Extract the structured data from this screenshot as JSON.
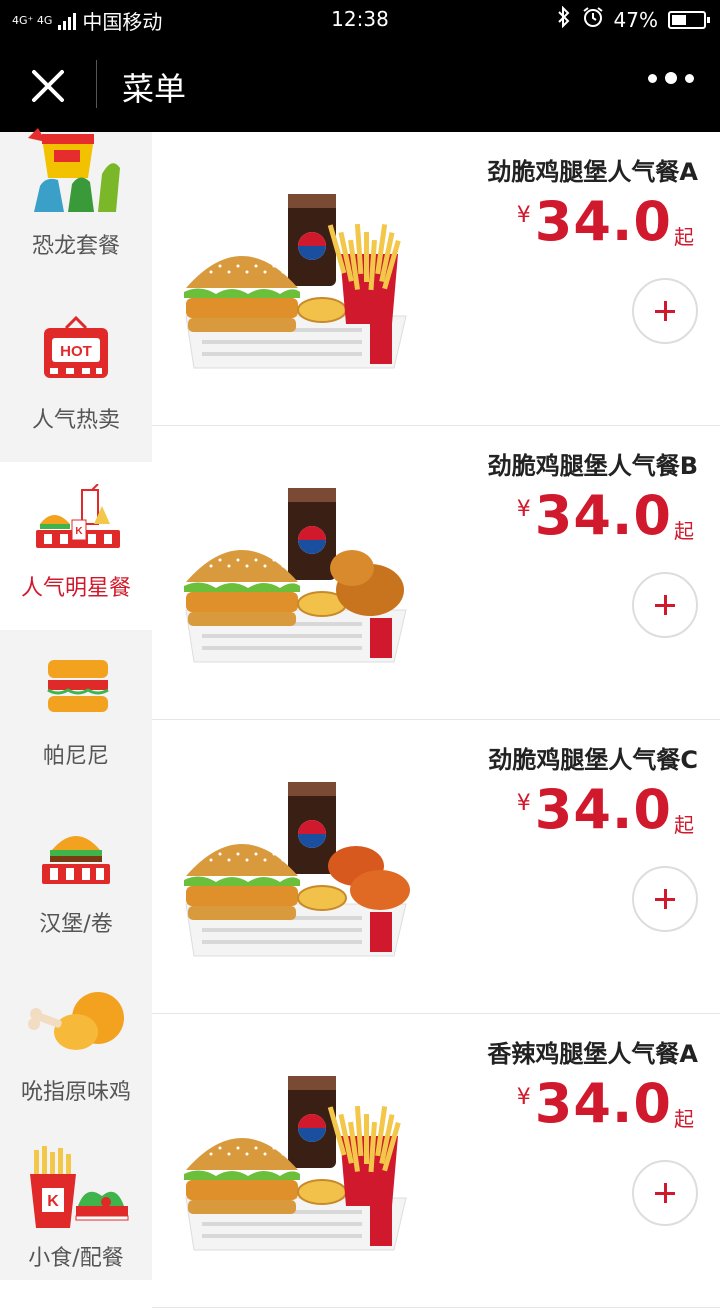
{
  "status": {
    "network": "4G⁺ 4G",
    "carrier": "中国移动",
    "time": "12:38",
    "battery": "47%",
    "battery_level": 0.47
  },
  "header": {
    "title": "菜单",
    "close_icon": "close-icon",
    "more_icon": "more-dots-icon"
  },
  "sidebar": {
    "items": [
      {
        "label": "恐龙套餐",
        "icon": "dinosaur-meal-icon",
        "active": false
      },
      {
        "label": "人气热卖",
        "icon": "hot-sign-icon",
        "active": false
      },
      {
        "label": "人气明星餐",
        "icon": "star-meal-icon",
        "active": true
      },
      {
        "label": "帕尼尼",
        "icon": "panini-icon",
        "active": false
      },
      {
        "label": "汉堡/卷",
        "icon": "burger-icon",
        "active": false
      },
      {
        "label": "吮指原味鸡",
        "icon": "chicken-drumstick-icon",
        "active": false
      },
      {
        "label": "小食/配餐",
        "icon": "fries-snack-icon",
        "active": false
      }
    ]
  },
  "products": [
    {
      "name": "劲脆鸡腿堡人气餐A",
      "currency": "¥",
      "price": "34.0",
      "suffix": "起",
      "side": "fries"
    },
    {
      "name": "劲脆鸡腿堡人气餐B",
      "currency": "¥",
      "price": "34.0",
      "suffix": "起",
      "side": "chicken"
    },
    {
      "name": "劲脆鸡腿堡人气餐C",
      "currency": "¥",
      "price": "34.0",
      "suffix": "起",
      "side": "wings"
    },
    {
      "name": "香辣鸡腿堡人气餐A",
      "currency": "¥",
      "price": "34.0",
      "suffix": "起",
      "side": "fries"
    }
  ],
  "colors": {
    "accent": "#d0192c",
    "sidebar_bg": "#f3f3f3",
    "bar_bg": "#000000"
  }
}
